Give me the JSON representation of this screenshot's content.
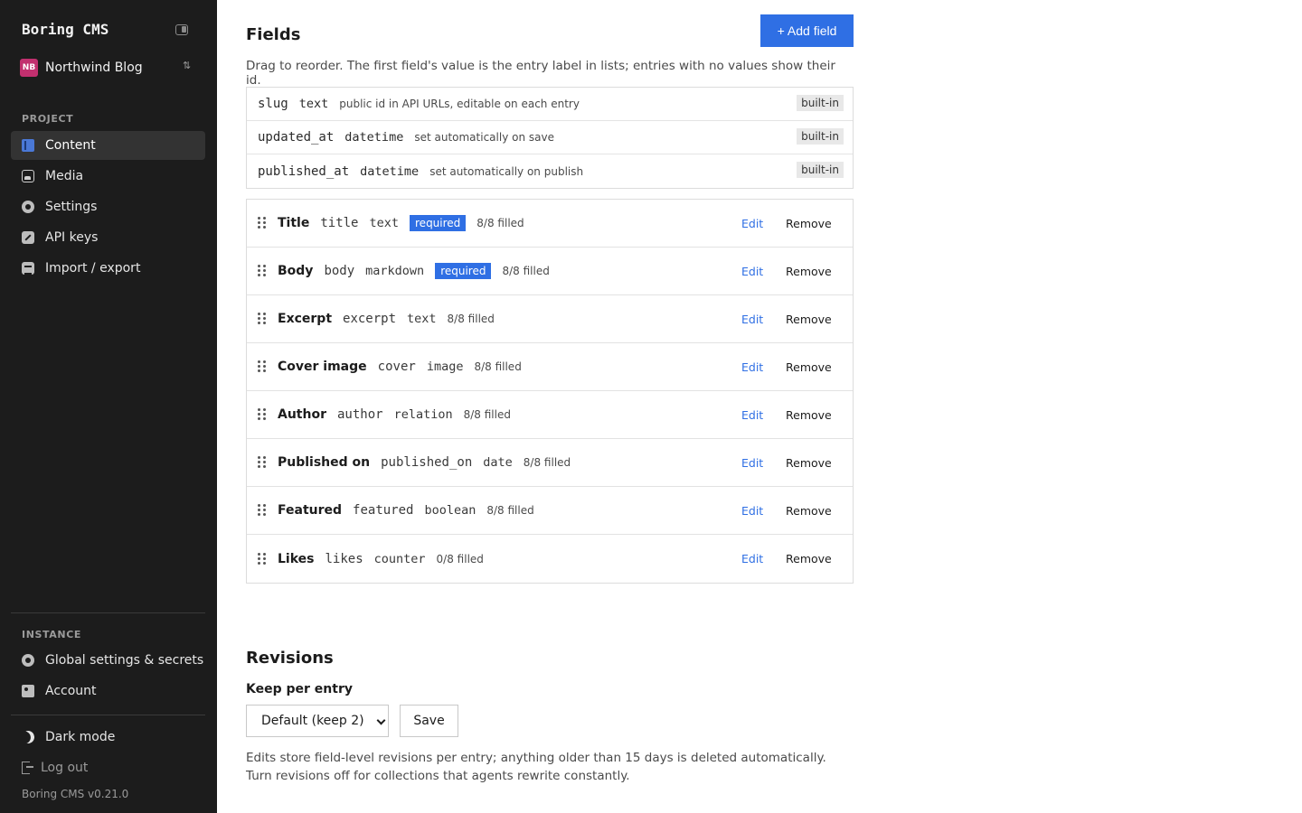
{
  "sidebar": {
    "brand": "Boring CMS",
    "project": {
      "initials": "NB",
      "name": "Northwind Blog"
    },
    "project_section": "PROJECT",
    "items": [
      {
        "label": "Content",
        "icon": "content-icon",
        "active": true
      },
      {
        "label": "Media",
        "icon": "media-icon"
      },
      {
        "label": "Settings",
        "icon": "settings-icon"
      },
      {
        "label": "API keys",
        "icon": "key-icon"
      },
      {
        "label": "Import / export",
        "icon": "import-export-icon"
      }
    ],
    "instance_section": "INSTANCE",
    "instance_items": [
      {
        "label": "Global settings & secrets",
        "icon": "settings-icon"
      },
      {
        "label": "Account",
        "icon": "account-icon"
      }
    ],
    "dark_mode": "Dark mode",
    "logout": "Log out",
    "version": "Boring CMS v0.21.0"
  },
  "fields": {
    "title": "Fields",
    "add_button": "+ Add field",
    "hint": "Drag to reorder. The first field's value is the entry label in lists; entries with no values show their id.",
    "builtin": [
      {
        "key": "slug",
        "type": "text",
        "desc": "public id in API URLs, editable on each entry",
        "badge": "built-in"
      },
      {
        "key": "updated_at",
        "type": "datetime",
        "desc": "set automatically on save",
        "badge": "built-in"
      },
      {
        "key": "published_at",
        "type": "datetime",
        "desc": "set automatically on publish",
        "badge": "built-in"
      }
    ],
    "rows": [
      {
        "label": "Title",
        "key": "title",
        "type": "text",
        "required": "required",
        "filled": "8/8 filled"
      },
      {
        "label": "Body",
        "key": "body",
        "type": "markdown",
        "required": "required",
        "filled": "8/8 filled"
      },
      {
        "label": "Excerpt",
        "key": "excerpt",
        "type": "text",
        "filled": "8/8 filled"
      },
      {
        "label": "Cover image",
        "key": "cover",
        "type": "image",
        "filled": "8/8 filled"
      },
      {
        "label": "Author",
        "key": "author",
        "type": "relation",
        "filled": "8/8 filled"
      },
      {
        "label": "Published on",
        "key": "published_on",
        "type": "date",
        "filled": "8/8 filled"
      },
      {
        "label": "Featured",
        "key": "featured",
        "type": "boolean",
        "filled": "8/8 filled"
      },
      {
        "label": "Likes",
        "key": "likes",
        "type": "counter",
        "filled": "0/8 filled"
      }
    ],
    "edit_label": "Edit",
    "remove_label": "Remove"
  },
  "revisions": {
    "title": "Revisions",
    "keep_label": "Keep per entry",
    "select_value": "Default (keep 2)",
    "save_label": "Save",
    "description": "Edits store field-level revisions per entry; anything older than 15 days is deleted automatically. Turn revisions off for collections that agents rewrite constantly."
  },
  "colors": {
    "accent": "#2f6fe4",
    "sidebar_bg": "#1c1c1c",
    "avatar": "#c2306f"
  }
}
